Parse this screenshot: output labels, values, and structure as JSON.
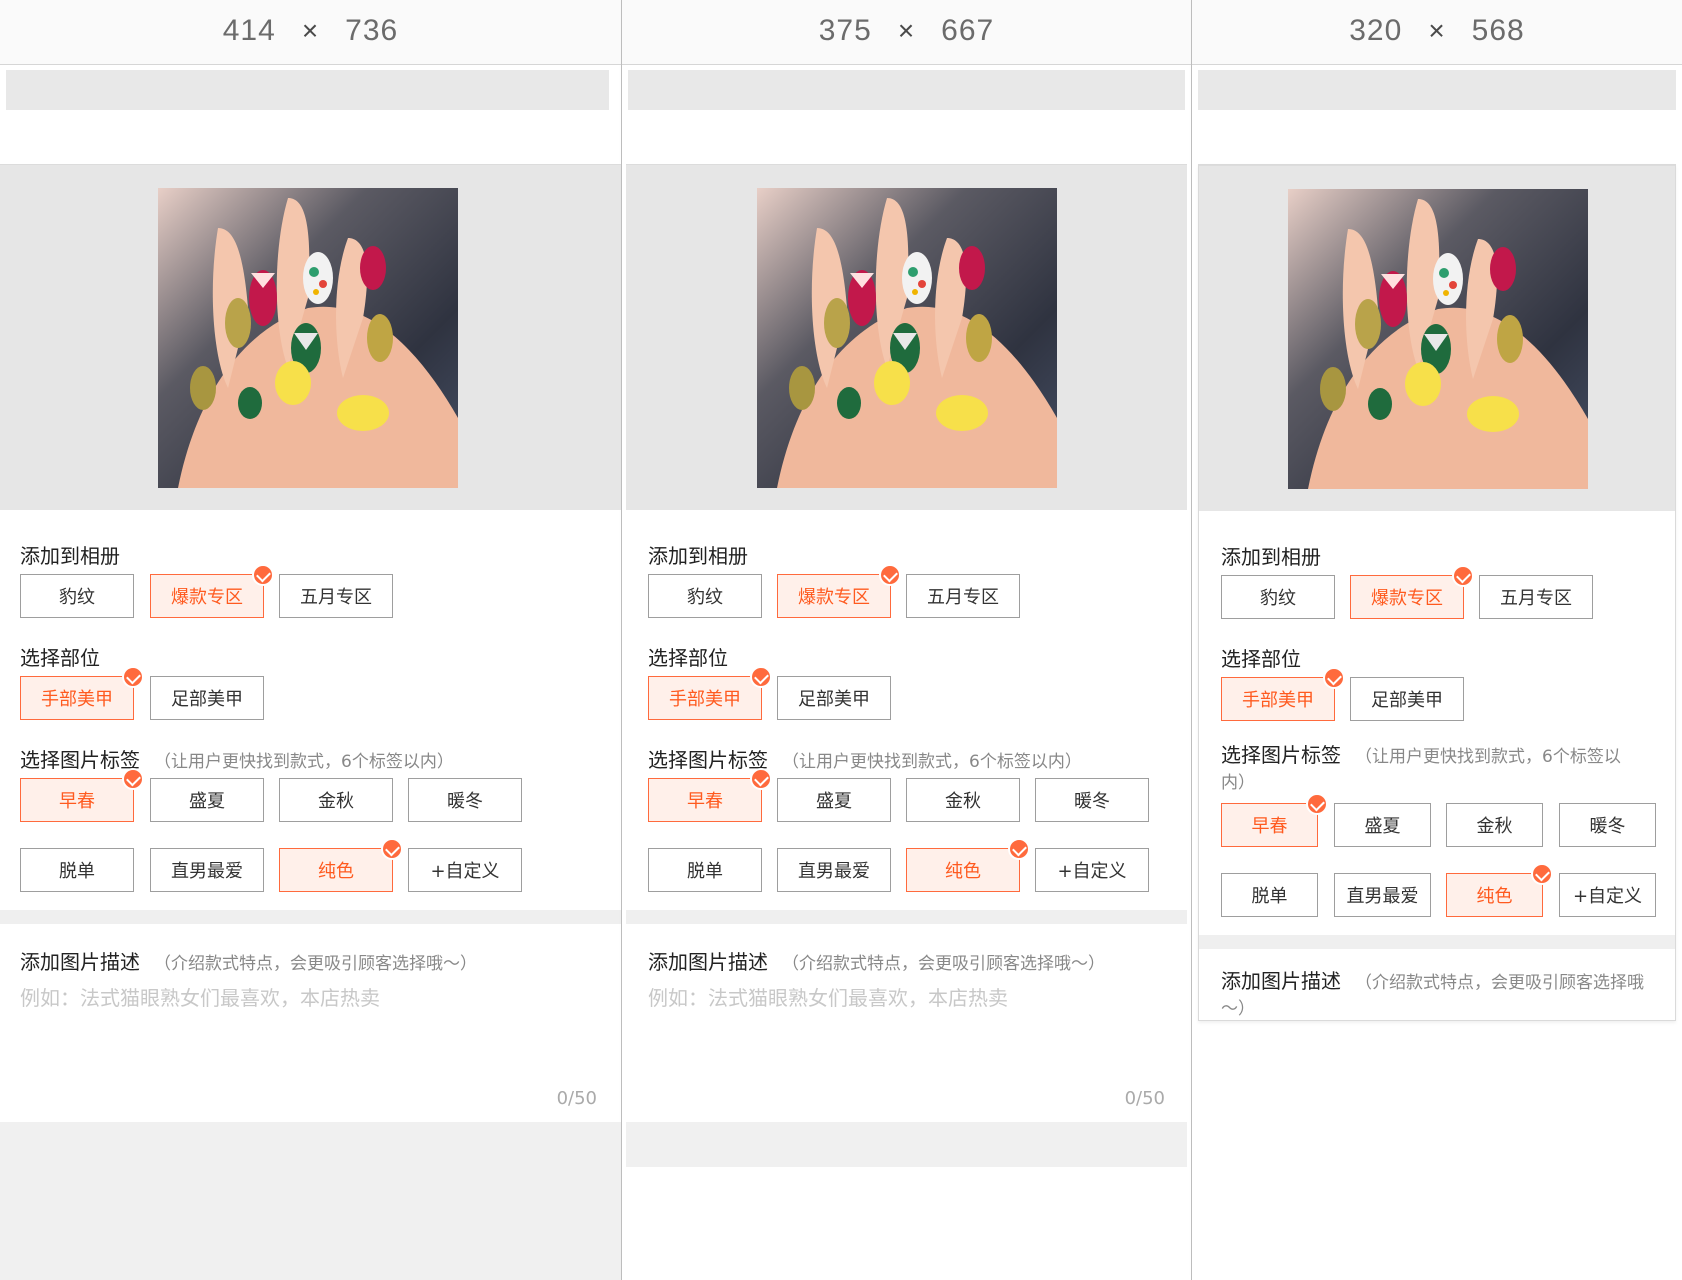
{
  "viewports": [
    {
      "size_w": "414",
      "size_h": "736",
      "times": "×"
    },
    {
      "size_w": "375",
      "size_h": "667",
      "times": "×"
    },
    {
      "size_w": "320",
      "size_h": "568",
      "times": "×"
    }
  ],
  "form": {
    "album_title": "添加到相册",
    "album_options": [
      "豹纹",
      "爆款专区",
      "五月专区"
    ],
    "album_selected": "爆款专区",
    "part_title": "选择部位",
    "part_options": [
      "手部美甲",
      "足部美甲"
    ],
    "part_selected": "手部美甲",
    "tag_title": "选择图片标签",
    "tag_hint": "（让用户更快找到款式，6个标签以内）",
    "tag_options": [
      "早春",
      "盛夏",
      "金秋",
      "暖冬",
      "脱单",
      "直男最爱",
      "纯色",
      "+自定义"
    ],
    "tag_selected": [
      "早春",
      "纯色"
    ],
    "desc_title": "添加图片描述",
    "desc_hint": "（介绍款式特点，会更吸引顾客选择哦～）",
    "desc_placeholder": "例如：法式猫眼熟女们最喜欢，本店热卖",
    "desc_counter": "0/50"
  },
  "colors": {
    "accent": "#ff6a3d",
    "accent_bg": "#fff0ea",
    "border": "#9e9e9e",
    "photo_band": "#e6e6e6"
  },
  "icons": {
    "selected_badge": "check-circle-icon"
  }
}
